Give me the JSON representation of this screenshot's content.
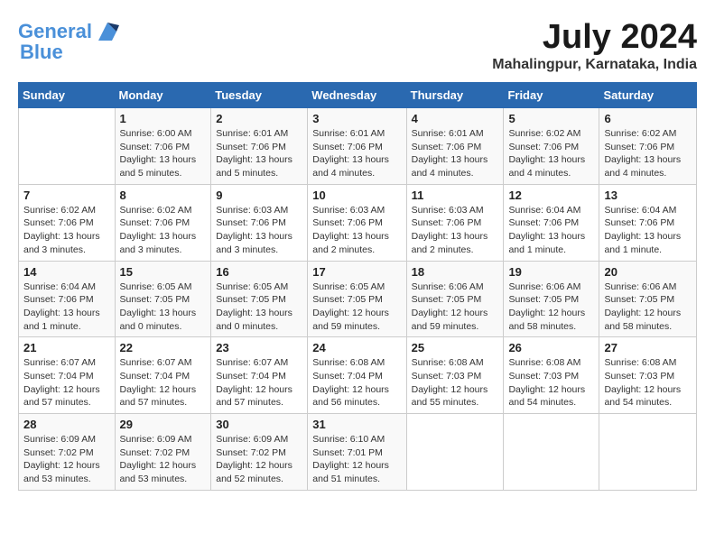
{
  "header": {
    "logo_line1": "General",
    "logo_line2": "Blue",
    "month_year": "July 2024",
    "location": "Mahalingpur, Karnataka, India"
  },
  "calendar": {
    "days_of_week": [
      "Sunday",
      "Monday",
      "Tuesday",
      "Wednesday",
      "Thursday",
      "Friday",
      "Saturday"
    ],
    "weeks": [
      [
        {
          "day": "",
          "detail": ""
        },
        {
          "day": "1",
          "detail": "Sunrise: 6:00 AM\nSunset: 7:06 PM\nDaylight: 13 hours\nand 5 minutes."
        },
        {
          "day": "2",
          "detail": "Sunrise: 6:01 AM\nSunset: 7:06 PM\nDaylight: 13 hours\nand 5 minutes."
        },
        {
          "day": "3",
          "detail": "Sunrise: 6:01 AM\nSunset: 7:06 PM\nDaylight: 13 hours\nand 4 minutes."
        },
        {
          "day": "4",
          "detail": "Sunrise: 6:01 AM\nSunset: 7:06 PM\nDaylight: 13 hours\nand 4 minutes."
        },
        {
          "day": "5",
          "detail": "Sunrise: 6:02 AM\nSunset: 7:06 PM\nDaylight: 13 hours\nand 4 minutes."
        },
        {
          "day": "6",
          "detail": "Sunrise: 6:02 AM\nSunset: 7:06 PM\nDaylight: 13 hours\nand 4 minutes."
        }
      ],
      [
        {
          "day": "7",
          "detail": "Sunrise: 6:02 AM\nSunset: 7:06 PM\nDaylight: 13 hours\nand 3 minutes."
        },
        {
          "day": "8",
          "detail": "Sunrise: 6:02 AM\nSunset: 7:06 PM\nDaylight: 13 hours\nand 3 minutes."
        },
        {
          "day": "9",
          "detail": "Sunrise: 6:03 AM\nSunset: 7:06 PM\nDaylight: 13 hours\nand 3 minutes."
        },
        {
          "day": "10",
          "detail": "Sunrise: 6:03 AM\nSunset: 7:06 PM\nDaylight: 13 hours\nand 2 minutes."
        },
        {
          "day": "11",
          "detail": "Sunrise: 6:03 AM\nSunset: 7:06 PM\nDaylight: 13 hours\nand 2 minutes."
        },
        {
          "day": "12",
          "detail": "Sunrise: 6:04 AM\nSunset: 7:06 PM\nDaylight: 13 hours\nand 1 minute."
        },
        {
          "day": "13",
          "detail": "Sunrise: 6:04 AM\nSunset: 7:06 PM\nDaylight: 13 hours\nand 1 minute."
        }
      ],
      [
        {
          "day": "14",
          "detail": "Sunrise: 6:04 AM\nSunset: 7:06 PM\nDaylight: 13 hours\nand 1 minute."
        },
        {
          "day": "15",
          "detail": "Sunrise: 6:05 AM\nSunset: 7:05 PM\nDaylight: 13 hours\nand 0 minutes."
        },
        {
          "day": "16",
          "detail": "Sunrise: 6:05 AM\nSunset: 7:05 PM\nDaylight: 13 hours\nand 0 minutes."
        },
        {
          "day": "17",
          "detail": "Sunrise: 6:05 AM\nSunset: 7:05 PM\nDaylight: 12 hours\nand 59 minutes."
        },
        {
          "day": "18",
          "detail": "Sunrise: 6:06 AM\nSunset: 7:05 PM\nDaylight: 12 hours\nand 59 minutes."
        },
        {
          "day": "19",
          "detail": "Sunrise: 6:06 AM\nSunset: 7:05 PM\nDaylight: 12 hours\nand 58 minutes."
        },
        {
          "day": "20",
          "detail": "Sunrise: 6:06 AM\nSunset: 7:05 PM\nDaylight: 12 hours\nand 58 minutes."
        }
      ],
      [
        {
          "day": "21",
          "detail": "Sunrise: 6:07 AM\nSunset: 7:04 PM\nDaylight: 12 hours\nand 57 minutes."
        },
        {
          "day": "22",
          "detail": "Sunrise: 6:07 AM\nSunset: 7:04 PM\nDaylight: 12 hours\nand 57 minutes."
        },
        {
          "day": "23",
          "detail": "Sunrise: 6:07 AM\nSunset: 7:04 PM\nDaylight: 12 hours\nand 57 minutes."
        },
        {
          "day": "24",
          "detail": "Sunrise: 6:08 AM\nSunset: 7:04 PM\nDaylight: 12 hours\nand 56 minutes."
        },
        {
          "day": "25",
          "detail": "Sunrise: 6:08 AM\nSunset: 7:03 PM\nDaylight: 12 hours\nand 55 minutes."
        },
        {
          "day": "26",
          "detail": "Sunrise: 6:08 AM\nSunset: 7:03 PM\nDaylight: 12 hours\nand 54 minutes."
        },
        {
          "day": "27",
          "detail": "Sunrise: 6:08 AM\nSunset: 7:03 PM\nDaylight: 12 hours\nand 54 minutes."
        }
      ],
      [
        {
          "day": "28",
          "detail": "Sunrise: 6:09 AM\nSunset: 7:02 PM\nDaylight: 12 hours\nand 53 minutes."
        },
        {
          "day": "29",
          "detail": "Sunrise: 6:09 AM\nSunset: 7:02 PM\nDaylight: 12 hours\nand 53 minutes."
        },
        {
          "day": "30",
          "detail": "Sunrise: 6:09 AM\nSunset: 7:02 PM\nDaylight: 12 hours\nand 52 minutes."
        },
        {
          "day": "31",
          "detail": "Sunrise: 6:10 AM\nSunset: 7:01 PM\nDaylight: 12 hours\nand 51 minutes."
        },
        {
          "day": "",
          "detail": ""
        },
        {
          "day": "",
          "detail": ""
        },
        {
          "day": "",
          "detail": ""
        }
      ]
    ]
  }
}
